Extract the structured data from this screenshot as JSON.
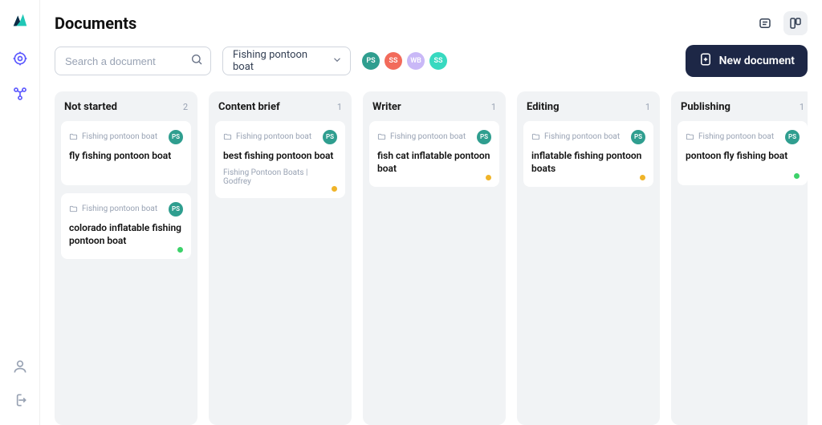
{
  "page": {
    "title": "Documents"
  },
  "search": {
    "placeholder": "Search a document"
  },
  "filter": {
    "value": "Fishing pontoon boat"
  },
  "avatars": [
    {
      "initials": "PS",
      "color": "#2f9e8f"
    },
    {
      "initials": "SS",
      "color": "#f26b5b"
    },
    {
      "initials": "WB",
      "color": "#c9b8f7"
    },
    {
      "initials": "SS",
      "color": "#38d9c0"
    }
  ],
  "new_document_label": "New document",
  "card_assignee": {
    "initials": "PS",
    "color": "#2f9e8f"
  },
  "columns": [
    {
      "title": "Not started",
      "count": "2",
      "cards": [
        {
          "folder": "Fishing pontoon boat",
          "title": "fly fishing pontoon boat",
          "subtitle": "",
          "dot": ""
        },
        {
          "folder": "Fishing pontoon boat",
          "title": "colorado inflatable fishing pontoon boat",
          "subtitle": "",
          "dot": "#3dd26a"
        }
      ]
    },
    {
      "title": "Content brief",
      "count": "1",
      "cards": [
        {
          "folder": "Fishing pontoon boat",
          "title": "best fishing pontoon boat",
          "subtitle": "Fishing Pontoon Boats | Godfrey",
          "dot": "#f0b429"
        }
      ]
    },
    {
      "title": "Writer",
      "count": "1",
      "cards": [
        {
          "folder": "Fishing pontoon boat",
          "title": "fish cat inflatable pontoon boat",
          "subtitle": "",
          "dot": "#f0b429"
        }
      ]
    },
    {
      "title": "Editing",
      "count": "1",
      "cards": [
        {
          "folder": "Fishing pontoon boat",
          "title": "inflatable fishing pontoon boats",
          "subtitle": "",
          "dot": "#f0b429"
        }
      ]
    },
    {
      "title": "Publishing",
      "count": "1",
      "cards": [
        {
          "folder": "Fishing pontoon boat",
          "title": "pontoon fly fishing boat",
          "subtitle": "",
          "dot": "#3dd26a"
        }
      ]
    }
  ]
}
